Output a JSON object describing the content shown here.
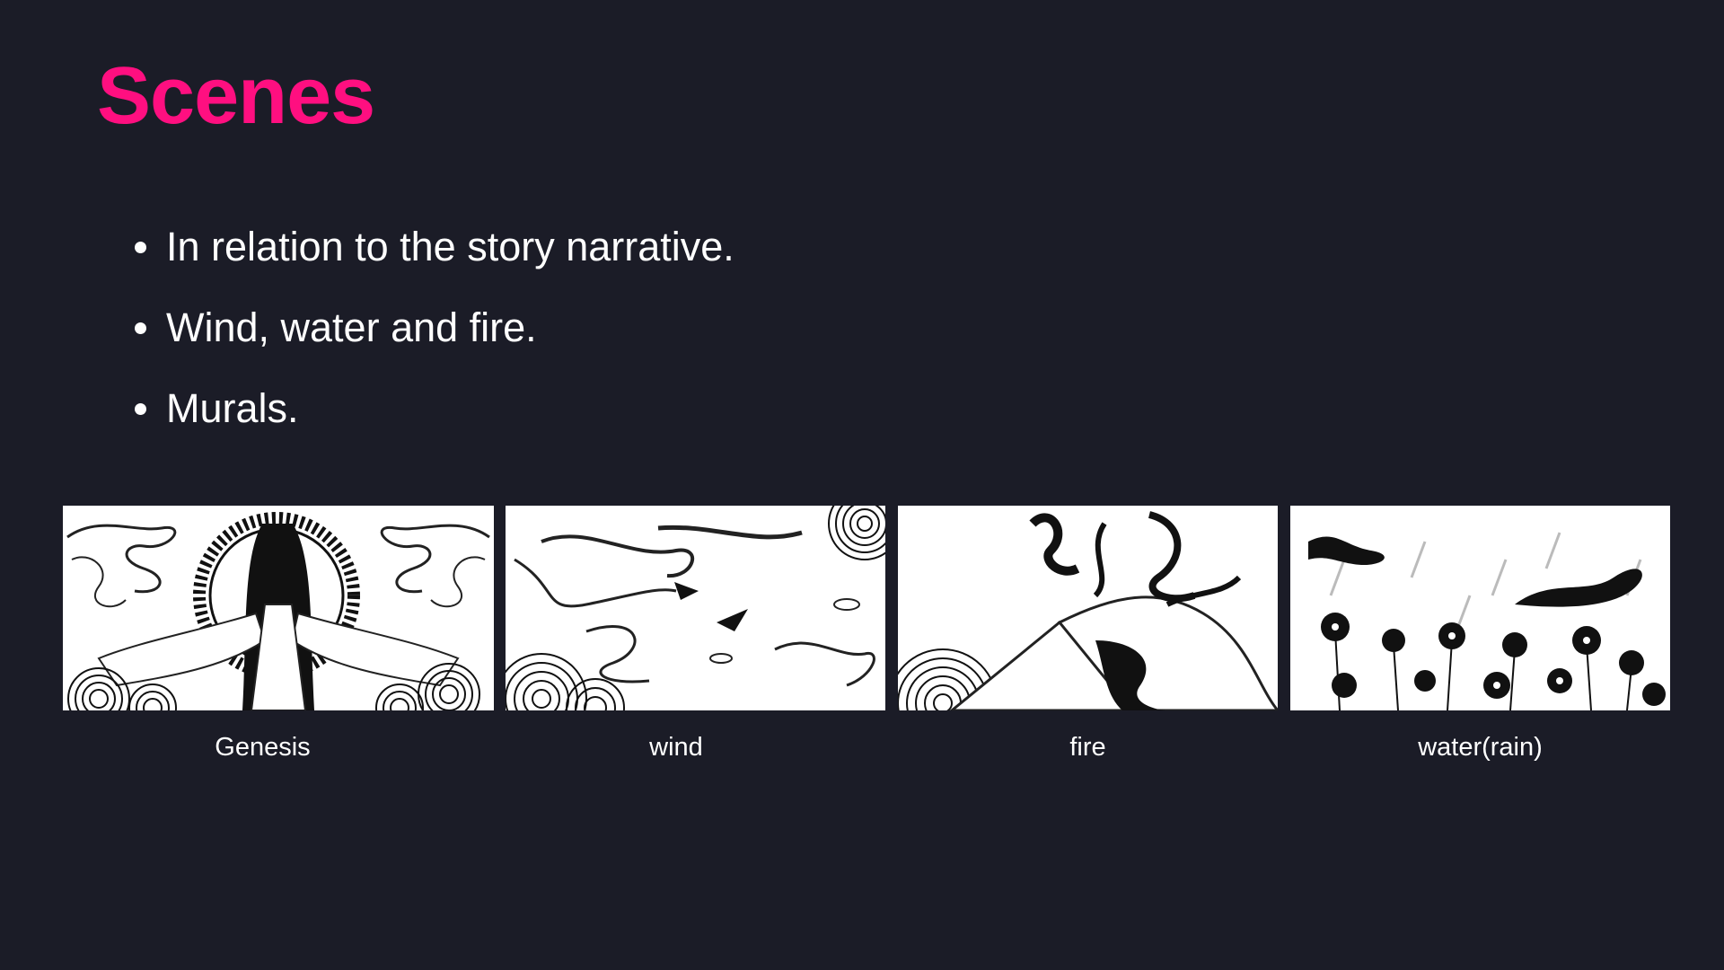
{
  "slide": {
    "title": "Scenes",
    "bullets": [
      "In relation to the story narrative.",
      "Wind, water and fire.",
      "Murals."
    ]
  },
  "scenes": [
    {
      "caption": "Genesis"
    },
    {
      "caption": "wind"
    },
    {
      "caption": "fire"
    },
    {
      "caption": "water(rain)"
    }
  ],
  "colors": {
    "background": "#1b1c27",
    "title": "#ff0f80",
    "text": "#ffffff"
  }
}
